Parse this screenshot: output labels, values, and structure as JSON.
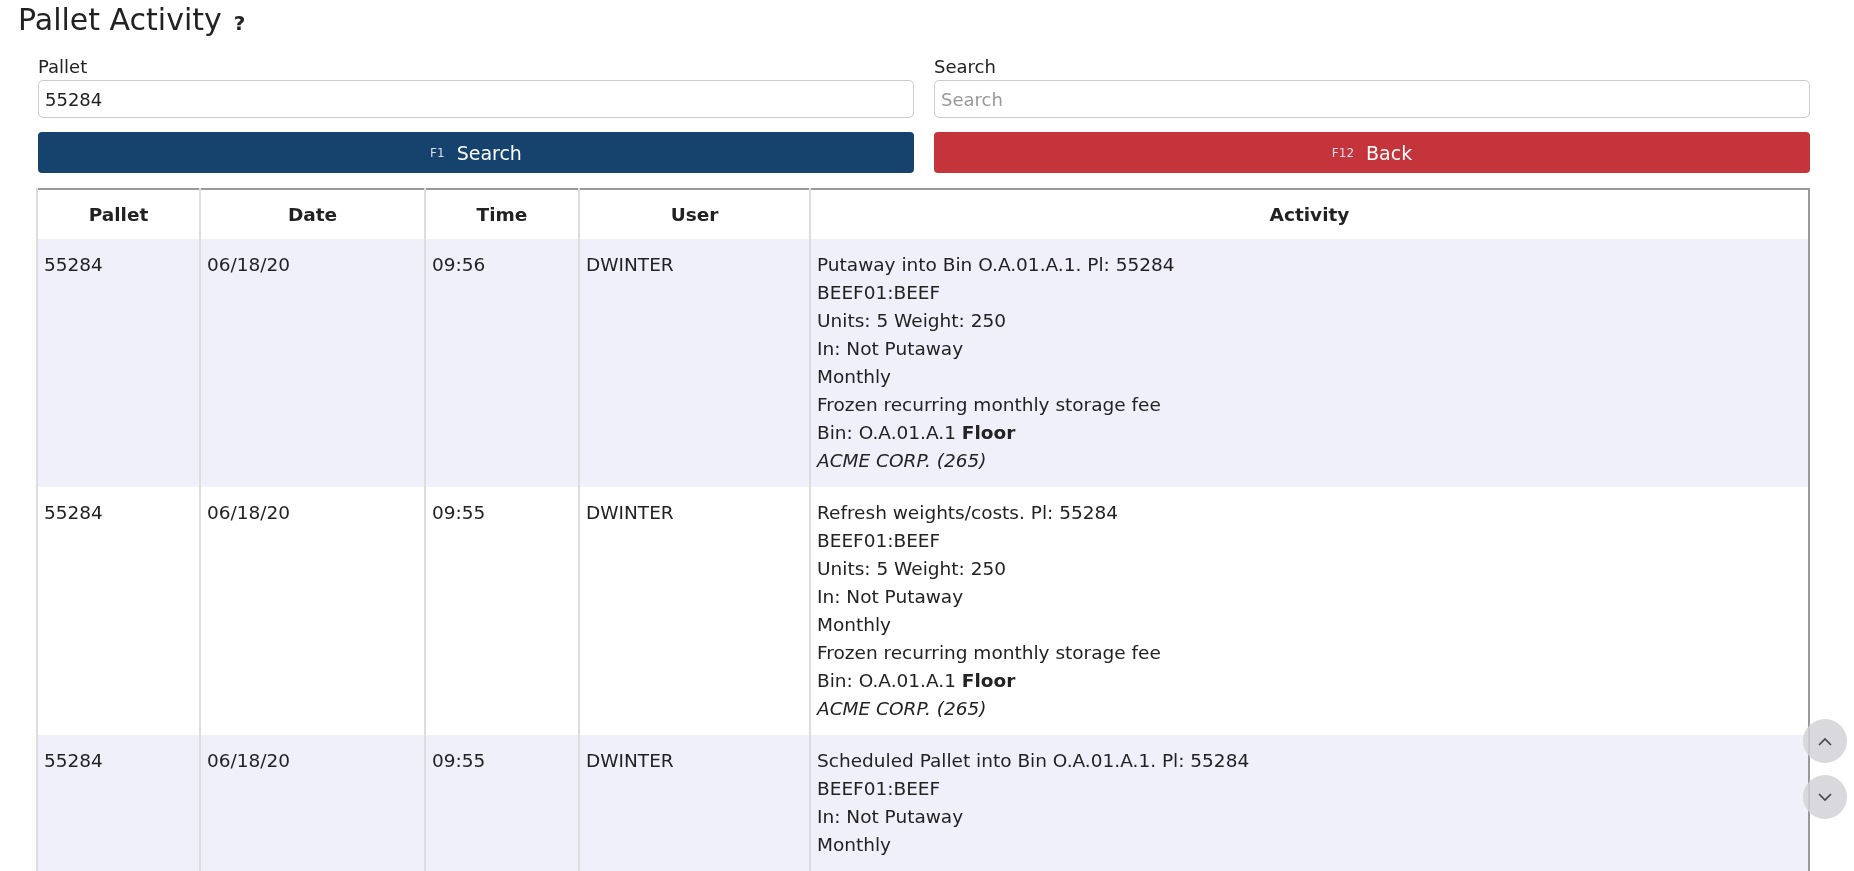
{
  "page": {
    "title": "Pallet Activity",
    "help": "?"
  },
  "filters": [
    {
      "label": "Pallet",
      "value": "55284"
    },
    {
      "label": "Search",
      "placeholder": "Search"
    }
  ],
  "buttons": [
    {
      "kind": "primary",
      "key": "F1",
      "label": "Search"
    },
    {
      "kind": "danger",
      "key": "F12",
      "label": "Back"
    }
  ],
  "table": {
    "columns": [
      "Pallet",
      "Date",
      "Time",
      "User",
      "Activity"
    ],
    "rows": [
      {
        "pallet": "55284",
        "date": "06/18/20",
        "time": "09:56",
        "user": "DWINTER",
        "activity": [
          {
            "kind": "plain",
            "text": "Putaway into Bin O.A.01.A.1. Pl: 55284"
          },
          {
            "kind": "plain",
            "text": "BEEF01:BEEF"
          },
          {
            "kind": "plain",
            "text": "Units: 5 Weight: 250"
          },
          {
            "kind": "plain",
            "text": "In: Not Putaway"
          },
          {
            "kind": "plain",
            "text": "Monthly"
          },
          {
            "kind": "plain",
            "text": "Frozen recurring monthly storage fee"
          },
          {
            "kind": "plain",
            "text": "Bin: O.A.01.A.1 **Floor**"
          },
          {
            "kind": "customer",
            "text": "ACME CORP. (265)"
          }
        ]
      },
      {
        "pallet": "55284",
        "date": "06/18/20",
        "time": "09:55",
        "user": "DWINTER",
        "activity": [
          {
            "kind": "plain",
            "text": "Refresh weights/costs. Pl: 55284"
          },
          {
            "kind": "plain",
            "text": "BEEF01:BEEF"
          },
          {
            "kind": "plain",
            "text": "Units: 5 Weight: 250"
          },
          {
            "kind": "plain",
            "text": "In: Not Putaway"
          },
          {
            "kind": "plain",
            "text": "Monthly"
          },
          {
            "kind": "plain",
            "text": "Frozen recurring monthly storage fee"
          },
          {
            "kind": "plain",
            "text": "Bin: O.A.01.A.1 **Floor**"
          },
          {
            "kind": "customer",
            "text": "ACME CORP. (265)"
          }
        ]
      },
      {
        "pallet": "55284",
        "date": "06/18/20",
        "time": "09:55",
        "user": "DWINTER",
        "activity": [
          {
            "kind": "plain",
            "text": "Scheduled Pallet into Bin O.A.01.A.1. Pl: 55284"
          },
          {
            "kind": "plain",
            "text": "BEEF01:BEEF"
          },
          {
            "kind": "plain",
            "text": "In: Not Putaway"
          },
          {
            "kind": "plain",
            "text": "Monthly"
          }
        ]
      }
    ]
  }
}
